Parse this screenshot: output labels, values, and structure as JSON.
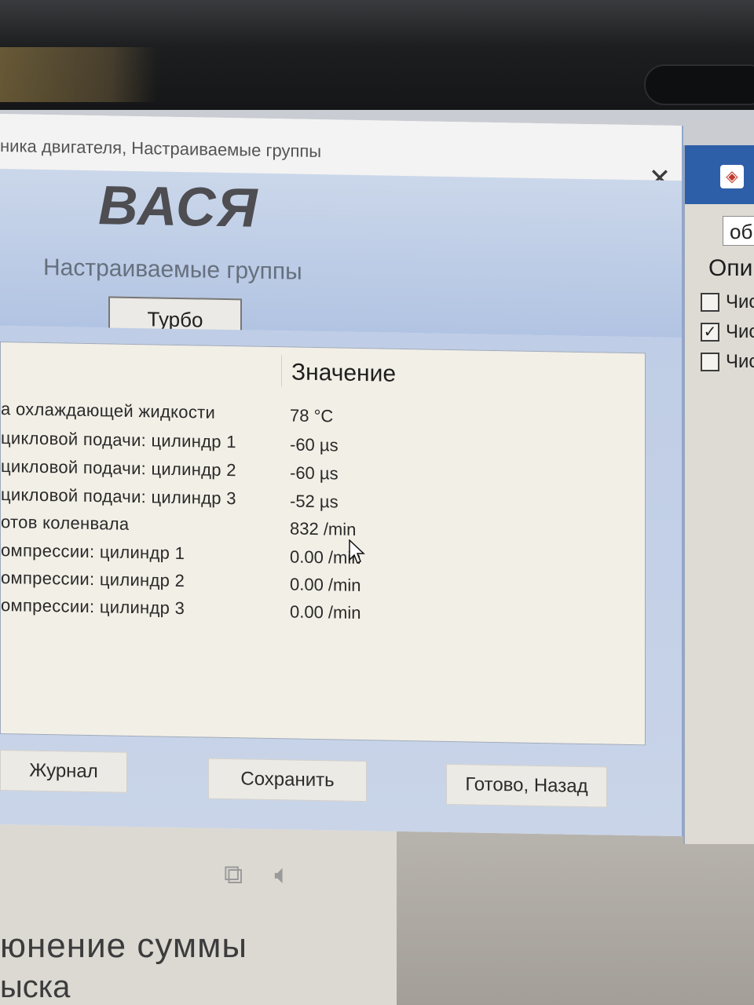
{
  "window": {
    "title": "ника двигателя,  Настраиваемые группы",
    "logo": "ВАСЯ",
    "subtitle": "Настраиваемые группы",
    "group_button": "Турбо",
    "close_icon": "close-icon"
  },
  "table": {
    "value_header": "Значение",
    "rows": [
      {
        "name": "а охлаждающей жидкости",
        "value": "78 °C"
      },
      {
        "name": " цикловой подачи: цилиндр 1",
        "value": "-60 µs"
      },
      {
        "name": " цикловой подачи: цилиндр 2",
        "value": "-60 µs"
      },
      {
        "name": " цикловой подачи: цилиндр 3",
        "value": "-52 µs"
      },
      {
        "name": "отов коленвала",
        "value": "832 /min"
      },
      {
        "name": "омпрессии: цилиндр 1",
        "value": "0.00 /min"
      },
      {
        "name": "омпрессии: цилиндр 2",
        "value": "0.00 /min"
      },
      {
        "name": "омпрессии: цилиндр 3",
        "value": "0.00 /min"
      }
    ]
  },
  "buttons": {
    "journal": "Журнал",
    "save": "Сохранить",
    "done_back": "Готово, Назад"
  },
  "side_panel": {
    "input_value": "об",
    "label": "Опи",
    "checks": [
      {
        "label": "Чис",
        "checked": false
      },
      {
        "label": "Чис",
        "checked": true
      },
      {
        "label": "Чис",
        "checked": false
      }
    ]
  },
  "background_text": {
    "line1": "юнение суммы",
    "line2": "ыска"
  },
  "colors": {
    "header_blue": "#b2c4e3",
    "table_bg": "#f2efe6",
    "side_header": "#2d5ea8"
  }
}
